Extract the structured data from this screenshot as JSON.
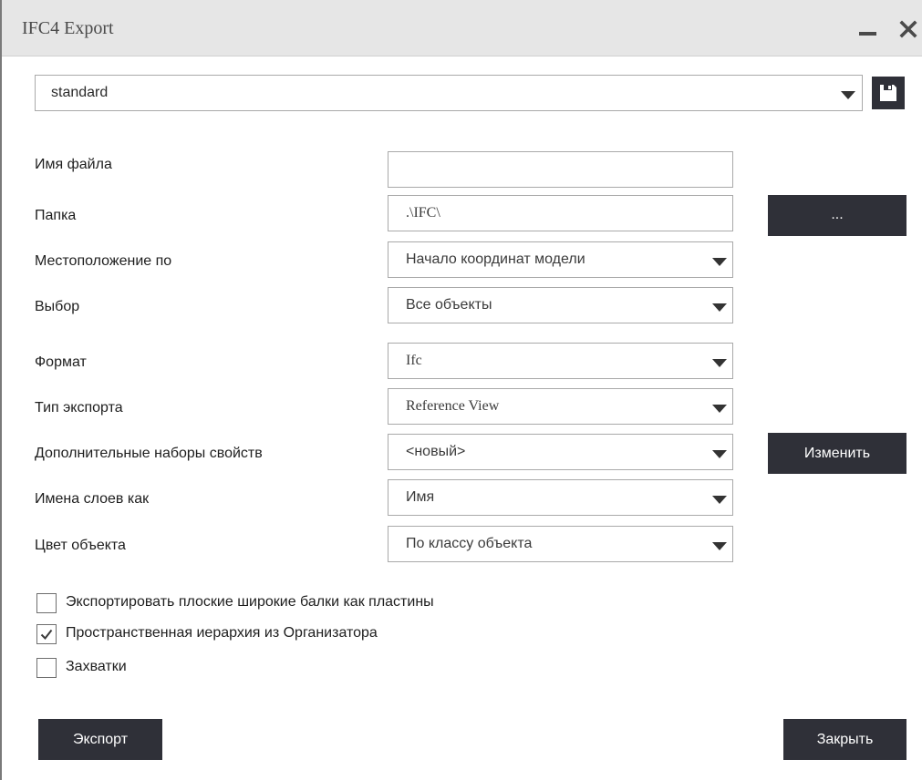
{
  "window": {
    "title": "IFC4 Export"
  },
  "profile": {
    "value": "standard"
  },
  "form": {
    "file_name": {
      "label": "Имя файла",
      "value": ""
    },
    "folder": {
      "label": "Папка",
      "value": ".\\IFC\\",
      "browse_label": "..."
    },
    "location": {
      "label": "Местоположение по",
      "value": "Начало координат модели"
    },
    "selection": {
      "label": "Выбор",
      "value": "Все объекты"
    },
    "format": {
      "label": "Формат",
      "value": "Ifc"
    },
    "export_type": {
      "label": "Тип экспорта",
      "value": "Reference View"
    },
    "property_sets": {
      "label": "Дополнительные наборы свойств",
      "value": "<новый>",
      "edit_label": "Изменить"
    },
    "layer_names": {
      "label": "Имена слоев как",
      "value": "Имя"
    },
    "object_color": {
      "label": "Цвет объекта",
      "value": "По классу объекта"
    }
  },
  "options": [
    {
      "label": "Экспортировать плоские широкие балки как пластины",
      "checked": false
    },
    {
      "label": "Пространственная иерархия из Организатора",
      "checked": true
    },
    {
      "label": "Захватки",
      "checked": false
    }
  ],
  "footer": {
    "export_label": "Экспорт",
    "close_label": "Закрыть"
  }
}
